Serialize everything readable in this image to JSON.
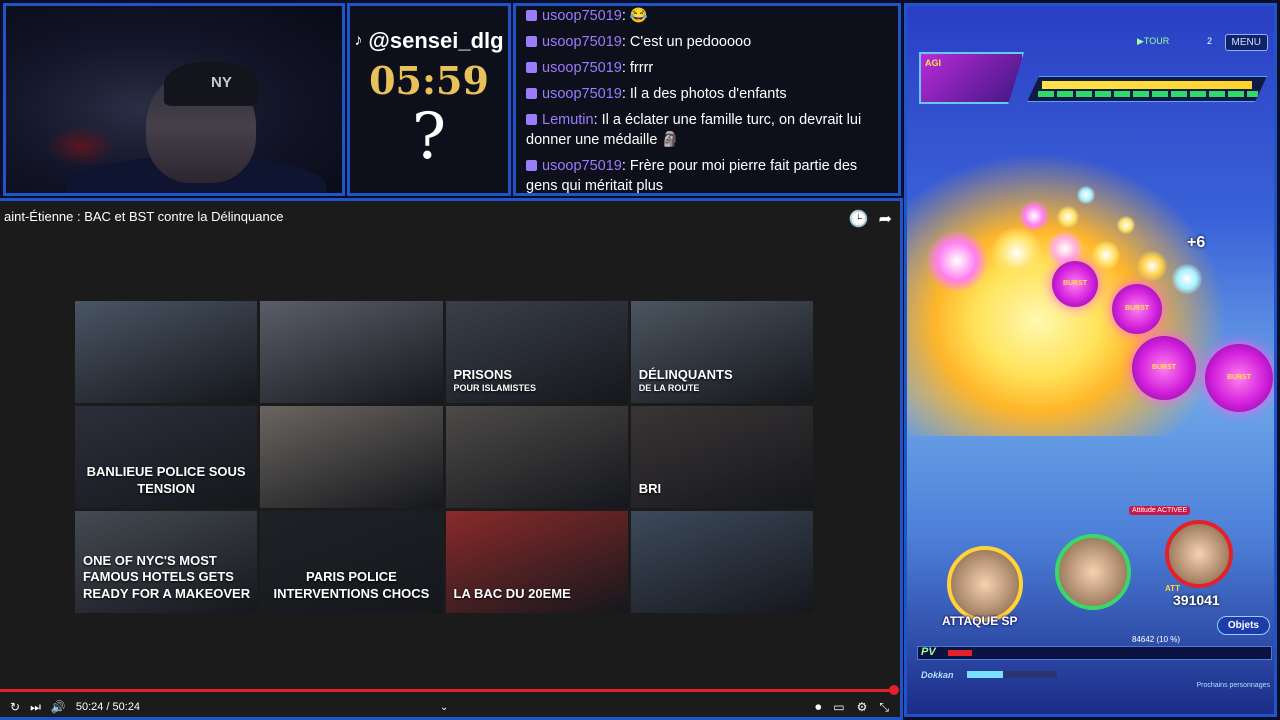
{
  "timer": {
    "handle": "@sensei_dlg",
    "time": "05:59",
    "mystery": "?"
  },
  "webcam": {
    "cap_mark": "NY"
  },
  "chat": {
    "messages": [
      {
        "user": "usoop75019",
        "text": "😂"
      },
      {
        "user": "usoop75019",
        "text": "C'est un pedooooo"
      },
      {
        "user": "usoop75019",
        "text": "frrrr"
      },
      {
        "user": "usoop75019",
        "text": "Il a des photos d'enfants"
      },
      {
        "user": "Lemutin",
        "text": "Il a éclater une famille turc, on devrait lui donner une médaille 🗿"
      },
      {
        "user": "usoop75019",
        "text": "Frère pour moi pierre fait partie des gens qui méritait plus"
      }
    ]
  },
  "player": {
    "title": "aint-Étienne : BAC et BST contre la Délinquance",
    "time_display": "50:24 / 50:24",
    "progress": 1.0,
    "thumbnails": [
      {
        "big": "",
        "small": "",
        "color": "#4a5564"
      },
      {
        "big": "",
        "small": "",
        "color": "#5a5e68"
      },
      {
        "big": "PRISONS",
        "small": "POUR ISLAMISTES",
        "color": "#3a3f4a"
      },
      {
        "big": "DÉLINQUANTS",
        "small": "DE LA ROUTE",
        "color": "#4c5560"
      },
      {
        "big": "BANLIEUE POLICE SOUS TENSION",
        "small": "",
        "color": "#2c2f3a"
      },
      {
        "big": "",
        "small": "",
        "color": "#6a6560"
      },
      {
        "big": "",
        "small": "",
        "color": "#4d4a48"
      },
      {
        "big": "BRI",
        "small": "",
        "color": "#3a3535"
      },
      {
        "big": "ONE OF NYC'S MOST FAMOUS HOTELS GETS READY FOR A MAKEOVER",
        "small": "",
        "color": "#454a52"
      },
      {
        "big": "PARIS POLICE INTERVENTIONS CHOCS",
        "small": "",
        "color": "#1e2226"
      },
      {
        "big": "LA BAC DU 20EME",
        "small": "",
        "color": "#8a2a2a"
      },
      {
        "big": "",
        "small": "",
        "color": "#3d4a5c"
      }
    ]
  },
  "game": {
    "menu": "MENU",
    "tour_label": "▶TOUR",
    "tour_num": "2",
    "type_label": "AGI",
    "attaque": "ATTAQUE SP",
    "att_label": "ATT",
    "att_value": "391041",
    "objets": "Objets",
    "pv": "PV",
    "hp_text": "84642 (10 %)",
    "hp_fraction": 0.1,
    "dokkan": "Dokkan",
    "next": "Prochains personnages",
    "active": "Attitude ACTIVEE",
    "plus": "+6",
    "burst": "BURST"
  }
}
